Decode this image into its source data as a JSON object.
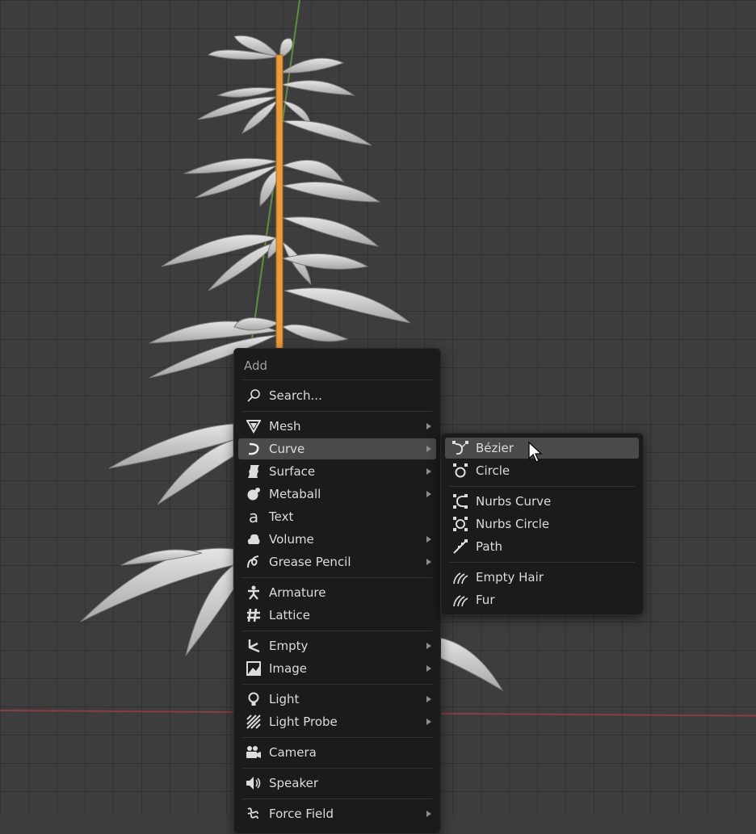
{
  "add_menu": {
    "title": "Add",
    "search_label": "Search...",
    "items": [
      {
        "label": "Mesh",
        "icon": "mesh-icon",
        "submenu": true
      },
      {
        "label": "Curve",
        "icon": "curve-icon",
        "submenu": true,
        "active": true
      },
      {
        "label": "Surface",
        "icon": "surface-icon",
        "submenu": true
      },
      {
        "label": "Metaball",
        "icon": "metaball-icon",
        "submenu": true
      },
      {
        "label": "Text",
        "icon": "text-icon",
        "submenu": false
      },
      {
        "label": "Volume",
        "icon": "volume-icon",
        "submenu": true
      },
      {
        "label": "Grease Pencil",
        "icon": "grease-pencil-icon",
        "submenu": true
      },
      {
        "label": "Armature",
        "icon": "armature-icon",
        "submenu": false
      },
      {
        "label": "Lattice",
        "icon": "lattice-icon",
        "submenu": false
      },
      {
        "label": "Empty",
        "icon": "empty-icon",
        "submenu": true
      },
      {
        "label": "Image",
        "icon": "image-icon",
        "submenu": true
      },
      {
        "label": "Light",
        "icon": "light-icon",
        "submenu": true
      },
      {
        "label": "Light Probe",
        "icon": "light-probe-icon",
        "submenu": true
      },
      {
        "label": "Camera",
        "icon": "camera-icon",
        "submenu": false
      },
      {
        "label": "Speaker",
        "icon": "speaker-icon",
        "submenu": false
      },
      {
        "label": "Force Field",
        "icon": "force-field-icon",
        "submenu": true
      }
    ]
  },
  "curve_submenu": {
    "items": [
      {
        "label": "Bézier",
        "icon": "bezier-icon",
        "active": true
      },
      {
        "label": "Circle",
        "icon": "circle-curve-icon"
      },
      {
        "label": "Nurbs Curve",
        "icon": "nurbs-curve-icon"
      },
      {
        "label": "Nurbs Circle",
        "icon": "nurbs-circle-icon"
      },
      {
        "label": "Path",
        "icon": "path-icon"
      },
      {
        "label": "Empty Hair",
        "icon": "empty-hair-icon"
      },
      {
        "label": "Fur",
        "icon": "fur-icon"
      }
    ]
  },
  "colors": {
    "menu_bg": "#1b1b1b",
    "highlight": "#4a4a4a",
    "text": "#dcdcdc",
    "stem": "#e89a3c",
    "x_axis": "#8a3c43",
    "y_axis": "#5e8f3e"
  }
}
